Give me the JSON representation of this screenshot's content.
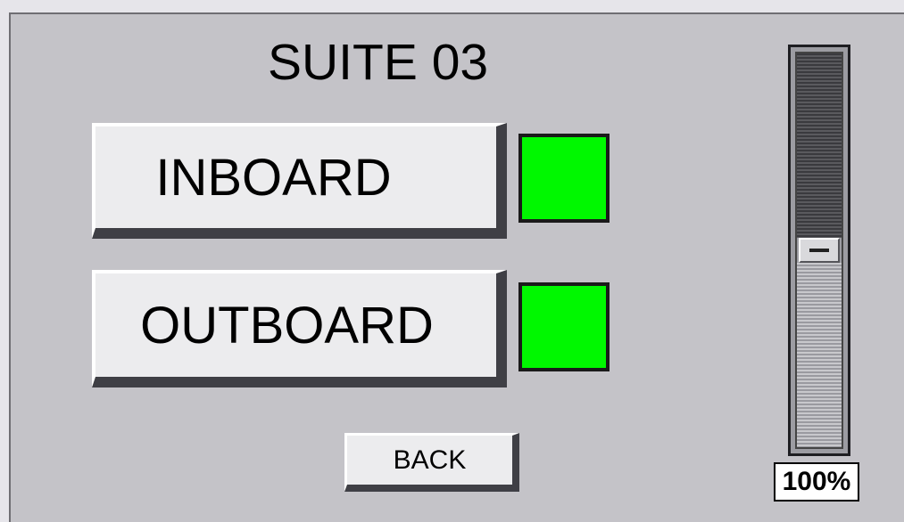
{
  "title": "SUITE 03",
  "buttons": {
    "inboard_label": "INBOARD",
    "outboard_label": "OUTBOARD",
    "back_label": "BACK"
  },
  "indicators": {
    "inboard": {
      "state": "on",
      "color": "#00f800"
    },
    "outboard": {
      "state": "on",
      "color": "#00f800"
    }
  },
  "slider": {
    "value_text": "100%",
    "thumb_position_fraction": 0.5
  },
  "colors": {
    "panel_bg": "#c4c3c8",
    "button_face": "#ececee",
    "indicator_on": "#00f800"
  }
}
